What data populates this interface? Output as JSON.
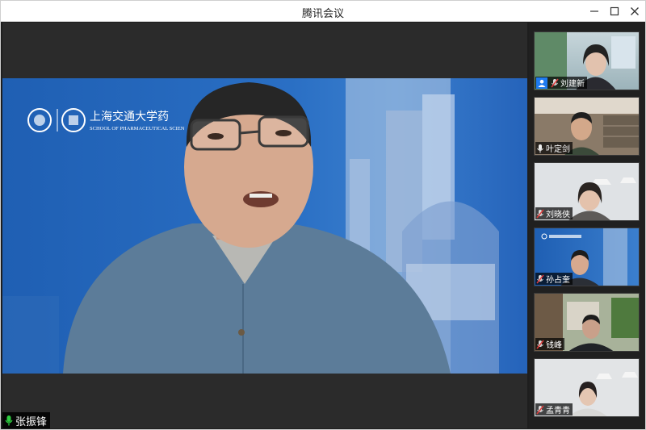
{
  "window": {
    "title": "腾讯会议"
  },
  "main": {
    "logo_text": "上海交通大学药",
    "logo_sub": "SCHOOL OF PHARMACEUTICAL SCIEN",
    "speaker_name": "张振锋"
  },
  "participants": [
    {
      "name": "刘建新",
      "role": "host"
    },
    {
      "name": "叶定剑",
      "role": "participant"
    },
    {
      "name": "刘晓侠",
      "role": "participant"
    },
    {
      "name": "孙占奎",
      "role": "participant"
    },
    {
      "name": "钱峰",
      "role": "participant"
    },
    {
      "name": "孟青青",
      "role": "participant"
    }
  ],
  "colors": {
    "accent": "#1e7bf0",
    "mic_active": "#2ecc40",
    "mic_muted": "#e03c3c"
  }
}
